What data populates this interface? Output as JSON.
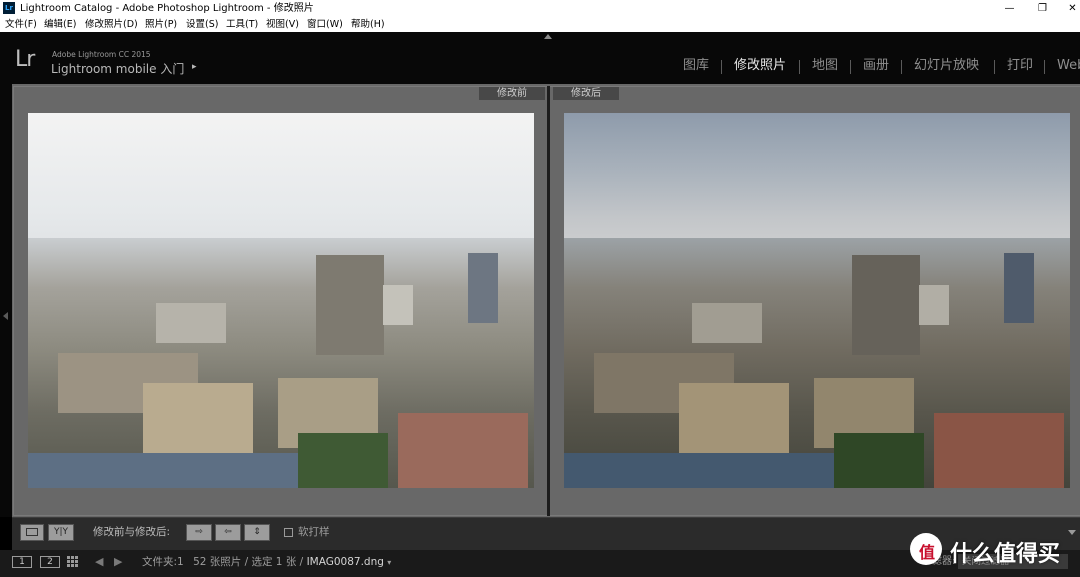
{
  "window": {
    "title": "Lightroom Catalog - Adobe Photoshop Lightroom - 修改照片",
    "icon_label": "Lr",
    "controls": [
      "—",
      "❐",
      "✕"
    ]
  },
  "menu": [
    "文件(F)",
    "编辑(E)",
    "修改照片(D)",
    "照片(P)",
    "设置(S)",
    "工具(T)",
    "视图(V)",
    "窗口(W)",
    "帮助(H)"
  ],
  "identity": {
    "logo": "Lr",
    "product": "Adobe Lightroom CC 2015",
    "main": "Lightroom mobile 入门",
    "arrow": "▸"
  },
  "modules": [
    {
      "label": "图库",
      "active": false
    },
    {
      "label": "修改照片",
      "active": true
    },
    {
      "label": "地图",
      "active": false
    },
    {
      "label": "画册",
      "active": false
    },
    {
      "label": "幻灯片放映",
      "active": false
    },
    {
      "label": "打印",
      "active": false
    },
    {
      "label": "Web",
      "active": false
    }
  ],
  "compare": {
    "before_label": "修改前",
    "after_label": "修改后"
  },
  "toolbar": {
    "view_loupe_icon": "loupe-icon",
    "view_yy_label": "Y|Y",
    "before_after_label": "修改前与修改后:",
    "copy_before_to_after": "⇨",
    "copy_after_to_before": "⇦",
    "swap": "⇕",
    "soft_proof_label": "软打样"
  },
  "filmstrip": {
    "view1": "1",
    "view2": "2",
    "source_prefix": "文件夹:1",
    "count_text": "52 张照片 / 选定 1 张 /",
    "filename": "IMAG0087.dng",
    "filter_label": "滤器:",
    "filter_value": "关闭过滤器"
  },
  "watermark": {
    "mark": "值",
    "text": "什么值得买"
  },
  "colors": {
    "accent_active": "#e6e6e6",
    "inactive_module": "#8f8f8f",
    "workspace": "#686868",
    "panel_dark": "#080808"
  }
}
